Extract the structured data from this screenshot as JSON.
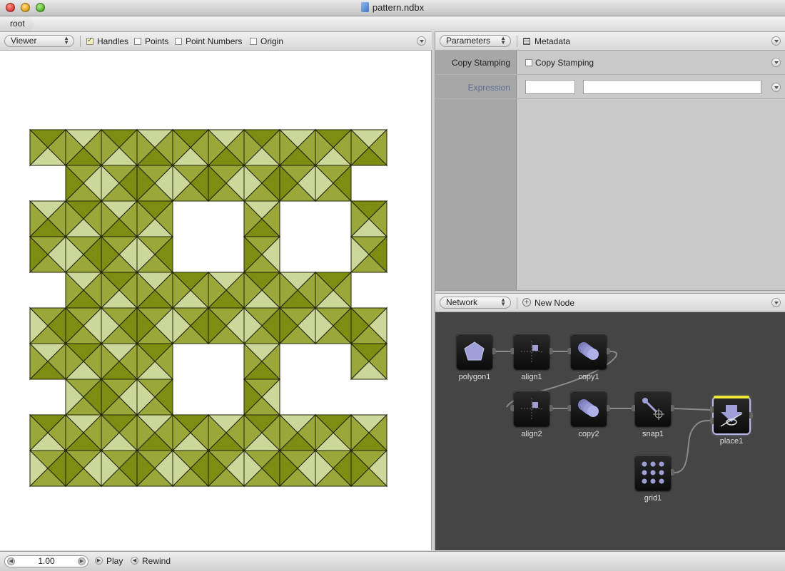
{
  "window": {
    "title": "pattern.ndbx"
  },
  "breadcrumb": {
    "root": "root"
  },
  "viewer_toolbar": {
    "mode": "Viewer",
    "options": [
      {
        "label": "Handles",
        "checked": true
      },
      {
        "label": "Points",
        "checked": false
      },
      {
        "label": "Point Numbers",
        "checked": false
      },
      {
        "label": "Origin",
        "checked": false
      }
    ]
  },
  "params_toolbar": {
    "mode": "Parameters",
    "metadata_label": "Metadata"
  },
  "parameters": {
    "rows": [
      {
        "label": "Copy Stamping",
        "checkbox_label": "Copy Stamping",
        "checked": false
      },
      {
        "label": "Expression",
        "value1": "",
        "value2": ""
      }
    ]
  },
  "network_toolbar": {
    "mode": "Network",
    "new_node_label": "New Node"
  },
  "nodes": [
    {
      "name": "polygon1",
      "icon": "polygon-icon"
    },
    {
      "name": "align1",
      "icon": "align-icon"
    },
    {
      "name": "copy1",
      "icon": "copy-icon"
    },
    {
      "name": "align2",
      "icon": "align-icon"
    },
    {
      "name": "copy2",
      "icon": "copy-icon"
    },
    {
      "name": "snap1",
      "icon": "snap-icon"
    },
    {
      "name": "place1",
      "icon": "place-icon",
      "rendered": true
    },
    {
      "name": "grid1",
      "icon": "grid-icon"
    }
  ],
  "playback": {
    "frame": "1.00",
    "play_label": "Play",
    "rewind_label": "Rewind"
  },
  "colors": {
    "tile_dark": "#7d8d12",
    "tile_mid": "#9aa83a",
    "tile_light": "#ccd79a",
    "network_bg": "#454545"
  }
}
